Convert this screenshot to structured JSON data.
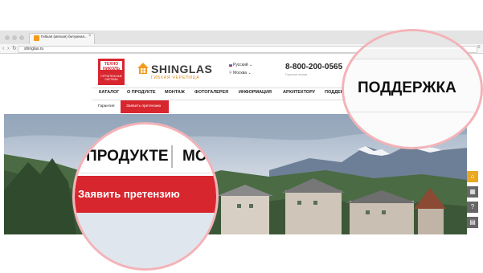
{
  "browser": {
    "tab_title": "Гибкая (мягкая) битумная...",
    "tab_close": "×",
    "url": "shinglas.ru",
    "back": "‹",
    "forward": "›",
    "reload": "↻",
    "menu": "≡"
  },
  "header": {
    "brand_logo_text": "ТЕХНО НИКОЛЬ",
    "brand_logo_sub": "СТРОИТЕЛЬНЫЕ СИСТЕМЫ",
    "logo_title": "SHINGLAS",
    "logo_subtitle": "ГИБКАЯ ЧЕРЕПИЦА",
    "language": "Русский ⌄",
    "city": "Москва ⌄",
    "phone": "8-800-200-0565",
    "phone_note": "Горячая линия"
  },
  "nav": {
    "items": [
      "КАТАЛОГ",
      "О ПРОДУКТЕ",
      "МОНТАЖ",
      "ФОТОГАЛЕРЕЯ",
      "ИНФОРМАЦИЯ",
      "АРХИТЕКТОРУ",
      "ПОДДЕРЖКА"
    ],
    "sub_items": [
      "Гарантия",
      "Заявить претензию"
    ]
  },
  "zoom": {
    "support": "ПОДДЕРЖКА",
    "about": "О ПРОДУКТЕ",
    "mo": "МО",
    "claim": "Заявить претензию"
  },
  "sidebar": {
    "icons": [
      "home-icon",
      "grid-icon",
      "help-icon",
      "calculator-icon"
    ]
  },
  "colors": {
    "accent": "#d8262f",
    "orange": "#f39a1c",
    "magnifier_border": "#f3b3b8"
  }
}
